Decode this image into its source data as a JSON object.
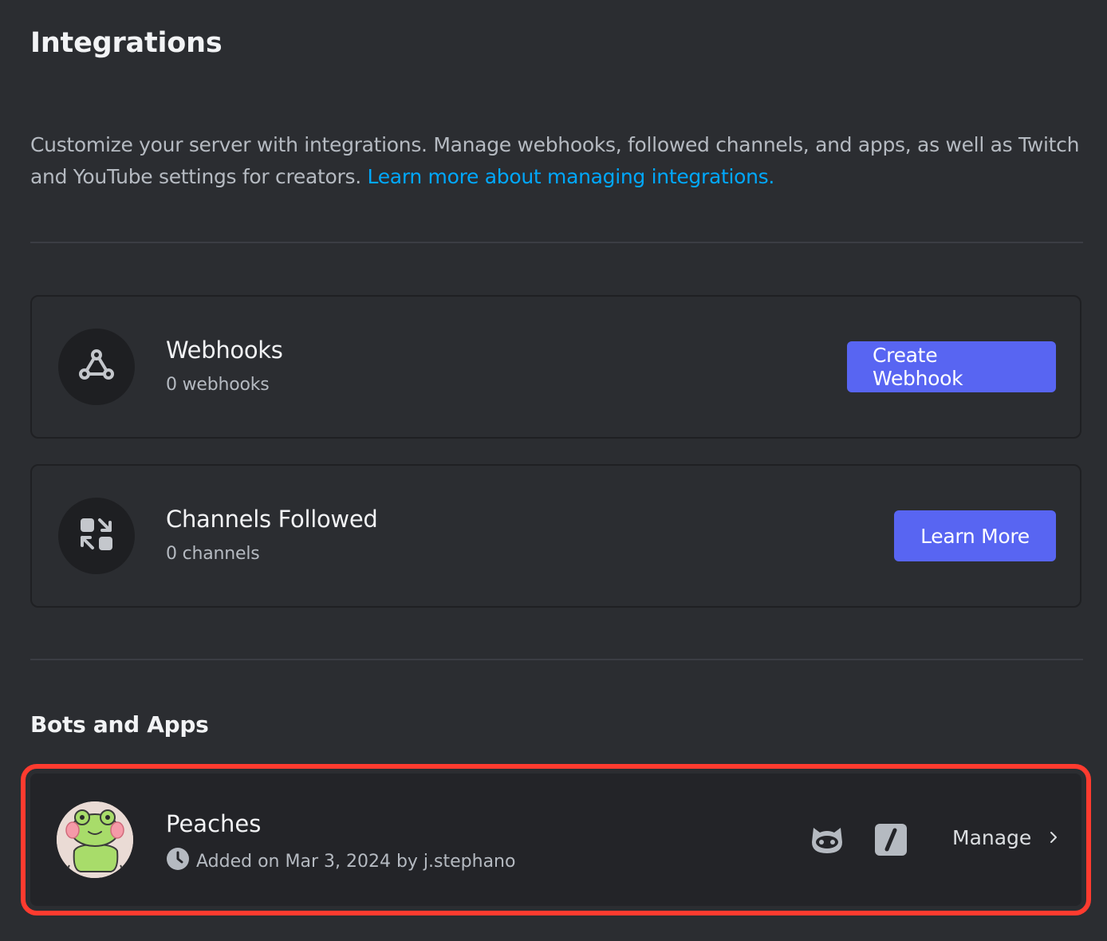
{
  "page": {
    "title": "Integrations",
    "description": "Customize your server with integrations. Manage webhooks, followed channels, and apps, as well as Twitch and YouTube settings for creators. ",
    "learn_more_link": "Learn more about managing integrations."
  },
  "webhooks": {
    "title": "Webhooks",
    "count": "0 webhooks",
    "button_label": "Create Webhook",
    "icon": "webhook-icon"
  },
  "channels_followed": {
    "title": "Channels Followed",
    "count": "0 channels",
    "button_label": "Learn More",
    "icon": "channel-follow-icon"
  },
  "bots_and_apps": {
    "heading": "Bots and Apps",
    "apps": [
      {
        "name": "Peaches",
        "added": "Added on Mar 3, 2024 by j.stephano",
        "manage_label": "Manage",
        "icons": [
          "bot-icon",
          "slash-commands-icon"
        ]
      }
    ]
  },
  "colors": {
    "background": "#2b2d31",
    "accent": "#5865f2",
    "link": "#00a8fc",
    "highlight": "#ff3b2f"
  }
}
